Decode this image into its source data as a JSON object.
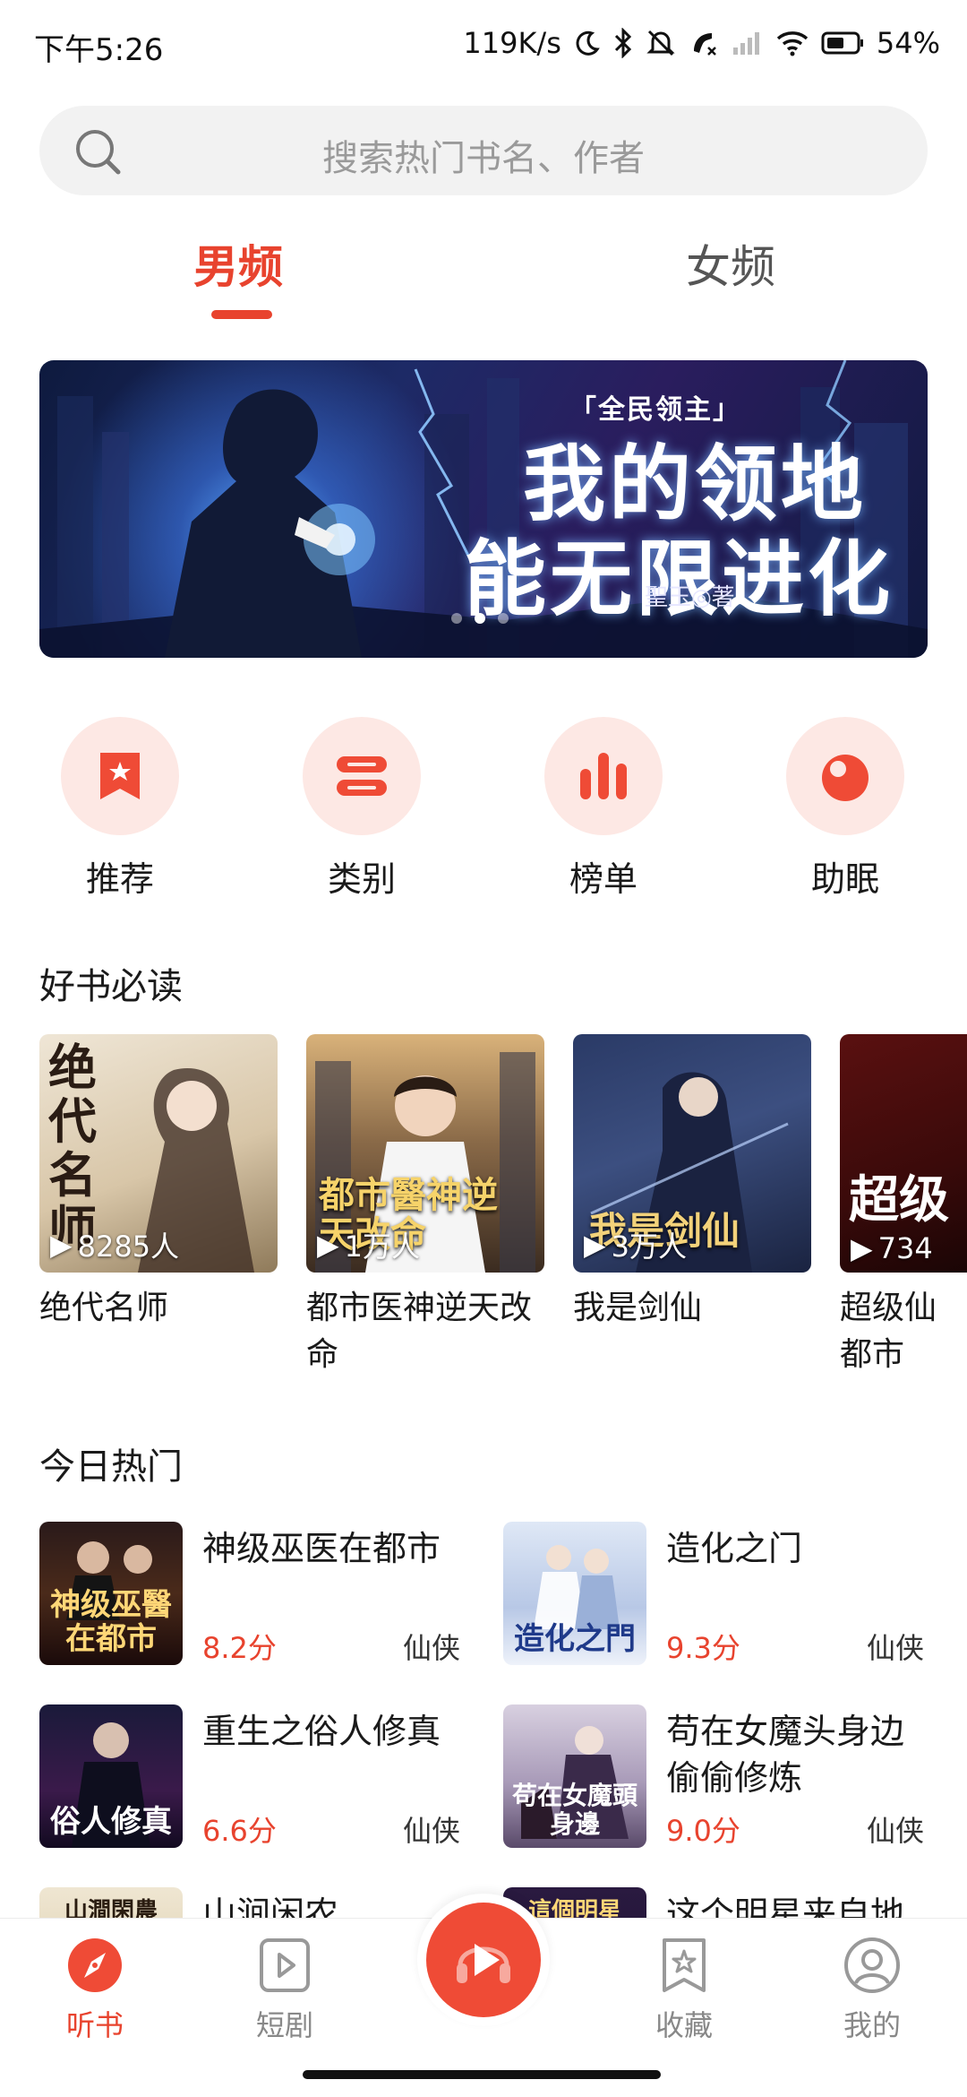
{
  "status_bar": {
    "time": "下午5:26",
    "network_speed": "119K/s",
    "battery": "54%",
    "icons": [
      "moon-icon",
      "bluetooth-icon",
      "mute-bell-icon",
      "call-icon",
      "signal-icon",
      "wifi-icon",
      "battery-icon"
    ]
  },
  "search": {
    "placeholder": "搜索热门书名、作者"
  },
  "tabs": [
    {
      "label": "男频",
      "active": true
    },
    {
      "label": "女频",
      "active": false
    }
  ],
  "banner": {
    "tag": "「全民领主」",
    "title_line1": "我的领地",
    "title_line2": "能无限进化",
    "author": "聖玉◎著",
    "pages": 3,
    "active_page": 2
  },
  "quick_nav": [
    {
      "label": "推荐",
      "icon": "bookmark-star-icon"
    },
    {
      "label": "类别",
      "icon": "category-icon"
    },
    {
      "label": "榜单",
      "icon": "ranking-icon"
    },
    {
      "label": "助眠",
      "icon": "moon-sleep-icon"
    }
  ],
  "must_read": {
    "title": "好书必读",
    "books": [
      {
        "title": "绝代名师",
        "count": "8285人",
        "cover_text": "绝代名师"
      },
      {
        "title": "都市医神逆天改命",
        "count": "1万人",
        "cover_text": "都市醫神逆天改命"
      },
      {
        "title": "我是剑仙",
        "count": "3万人",
        "cover_text": "我是剑仙"
      },
      {
        "title": "超级仙都市",
        "count": "734",
        "cover_text": "超级"
      }
    ]
  },
  "hot_today": {
    "title": "今日热门",
    "books": [
      {
        "title": "神级巫医在都市",
        "score": "8.2分",
        "genre": "仙侠",
        "cover_text": "神级巫醫在都市"
      },
      {
        "title": "造化之门",
        "score": "9.3分",
        "genre": "仙侠",
        "cover_text": "造化之門"
      },
      {
        "title": "重生之俗人修真",
        "score": "6.6分",
        "genre": "仙侠",
        "cover_text": "俗人修真"
      },
      {
        "title": "苟在女魔头身边偷偷修炼",
        "score": "9.0分",
        "genre": "仙侠",
        "cover_text": "苟在女魔頭身邊"
      },
      {
        "title": "山涧闲农",
        "score": "",
        "genre": "",
        "cover_text": "山澗閑農"
      },
      {
        "title": "这个明星来自地",
        "score": "",
        "genre": "",
        "cover_text": "這個明星"
      }
    ]
  },
  "bottom_nav": [
    {
      "label": "听书",
      "icon": "compass-icon",
      "active": true
    },
    {
      "label": "短剧",
      "icon": "video-icon",
      "active": false
    },
    {
      "label": "",
      "icon": "play-headphone-icon",
      "active": false
    },
    {
      "label": "收藏",
      "icon": "star-bookmark-icon",
      "active": false
    },
    {
      "label": "我的",
      "icon": "user-icon",
      "active": false
    }
  ],
  "colors": {
    "accent": "#e8432e",
    "accent_light": "#fde8e4",
    "text": "#1a1a1a",
    "muted": "#888888"
  }
}
